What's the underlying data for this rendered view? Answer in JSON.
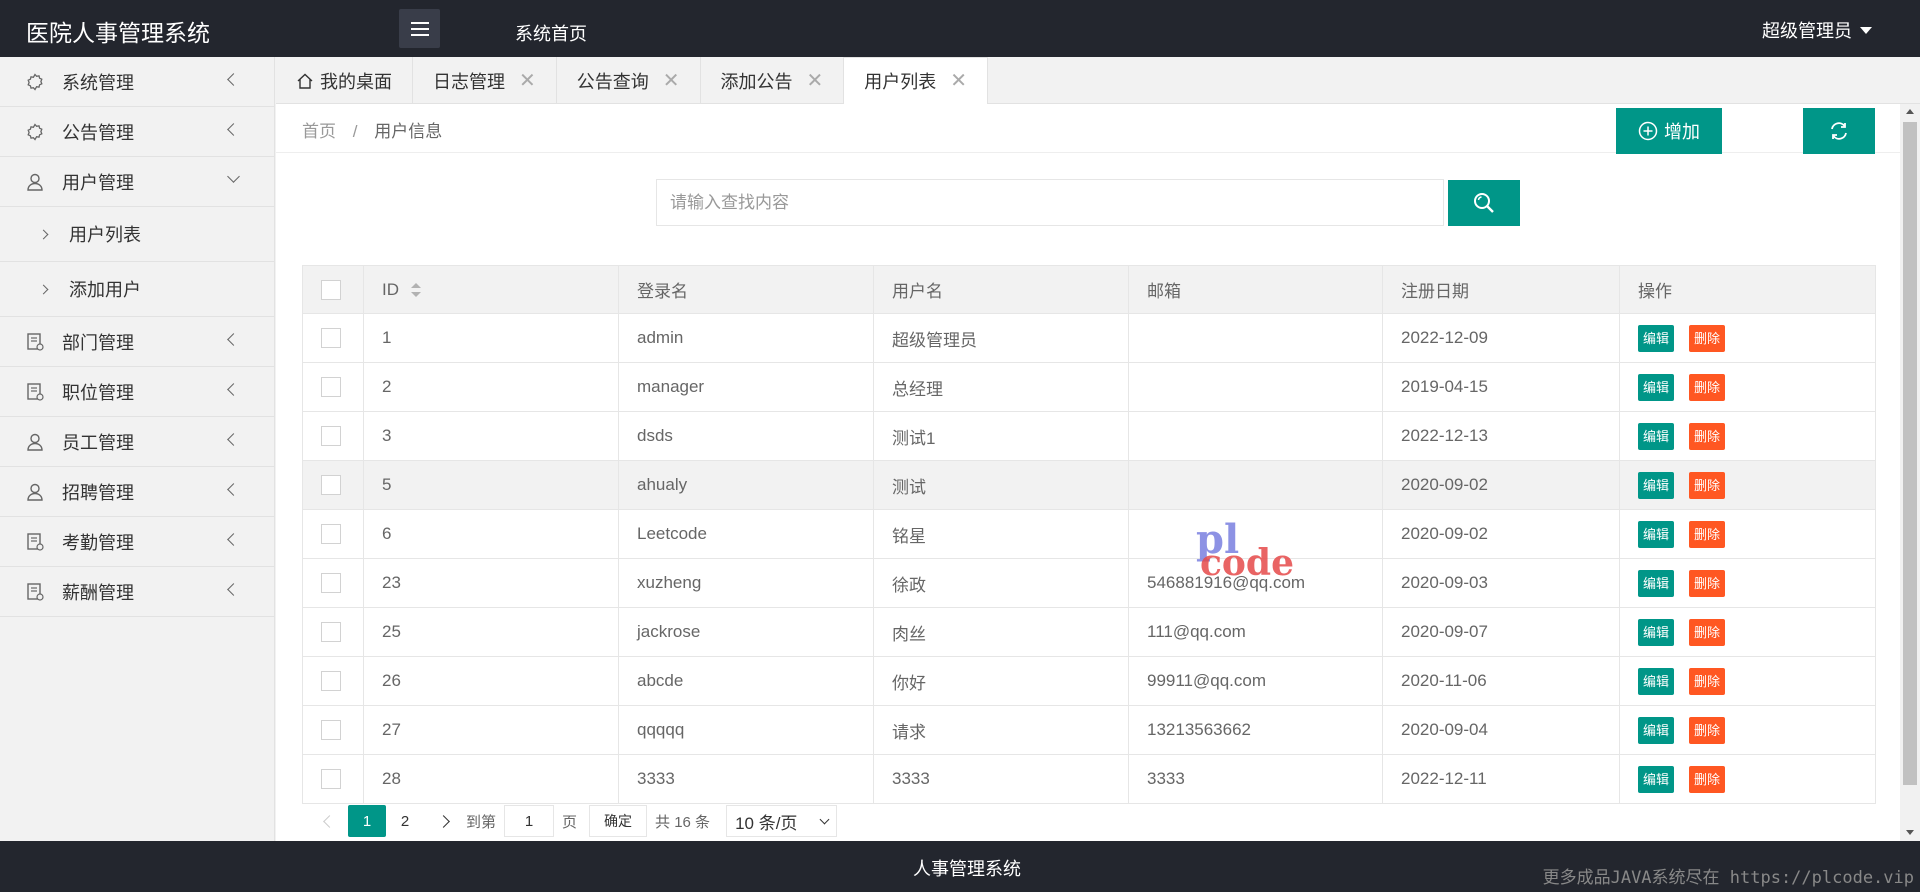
{
  "app": {
    "title": "医院人事管理系统",
    "home_link": "系统首页",
    "user": "超级管理员"
  },
  "sidebar": {
    "items": [
      {
        "label": "系统管理",
        "icon": "cog-icon"
      },
      {
        "label": "公告管理",
        "icon": "cog-icon"
      },
      {
        "label": "用户管理",
        "icon": "user-icon",
        "expanded": true,
        "children": [
          {
            "label": "用户列表"
          },
          {
            "label": "添加用户"
          }
        ]
      },
      {
        "label": "部门管理",
        "icon": "document-icon"
      },
      {
        "label": "职位管理",
        "icon": "document-icon"
      },
      {
        "label": "员工管理",
        "icon": "user-icon"
      },
      {
        "label": "招聘管理",
        "icon": "user-icon"
      },
      {
        "label": "考勤管理",
        "icon": "document-icon"
      },
      {
        "label": "薪酬管理",
        "icon": "document-icon"
      }
    ]
  },
  "tabs": [
    {
      "label": "我的桌面",
      "closable": false,
      "active": false
    },
    {
      "label": "日志管理",
      "closable": true,
      "active": false
    },
    {
      "label": "公告查询",
      "closable": true,
      "active": false
    },
    {
      "label": "添加公告",
      "closable": true,
      "active": false
    },
    {
      "label": "用户列表",
      "closable": true,
      "active": true
    }
  ],
  "tab_close_glyph": "✕",
  "breadcrumb": {
    "home": "首页",
    "separator": "/",
    "current": "用户信息"
  },
  "toolbar": {
    "add_label": "增加"
  },
  "search": {
    "placeholder": "请输入查找内容",
    "value": ""
  },
  "table": {
    "headers": [
      "ID",
      "登录名",
      "用户名",
      "邮箱",
      "注册日期",
      "操作"
    ],
    "edit_label": "编辑",
    "delete_label": "删除",
    "rows": [
      {
        "id": "1",
        "login": "admin",
        "name": "超级管理员",
        "email": "",
        "date": "2022-12-09"
      },
      {
        "id": "2",
        "login": "manager",
        "name": "总经理",
        "email": "",
        "date": "2019-04-15"
      },
      {
        "id": "3",
        "login": "dsds",
        "name": "测试1",
        "email": "",
        "date": "2022-12-13"
      },
      {
        "id": "5",
        "login": "ahualy",
        "name": "测试",
        "email": "",
        "date": "2020-09-02"
      },
      {
        "id": "6",
        "login": "Leetcode",
        "name": "铭星",
        "email": "",
        "date": "2020-09-02"
      },
      {
        "id": "23",
        "login": "xuzheng",
        "name": "徐政",
        "email": "546881916@qq.com",
        "date": "2020-09-03"
      },
      {
        "id": "25",
        "login": "jackrose",
        "name": "肉丝",
        "email": "111@qq.com",
        "date": "2020-09-07"
      },
      {
        "id": "26",
        "login": "abcde",
        "name": "你好",
        "email": "99911@qq.com",
        "date": "2020-11-06"
      },
      {
        "id": "27",
        "login": "qqqqq",
        "name": "请求",
        "email": "13213563662",
        "date": "2020-09-04"
      },
      {
        "id": "28",
        "login": "3333",
        "name": "3333",
        "email": "3333",
        "date": "2022-12-11"
      }
    ],
    "highlighted_row": 3
  },
  "pagination": {
    "pages": [
      "1",
      "2"
    ],
    "current": "1",
    "goto_prefix": "到第",
    "goto_value": "1",
    "goto_suffix": "页",
    "confirm": "确定",
    "total": "共 16 条",
    "page_size": "10 条/页"
  },
  "footer": {
    "text": "人事管理系统",
    "watermark": "更多成品JAVA系统尽在 https://plcode.vip"
  },
  "logo_watermark": {
    "top": "pl",
    "bottom": "code"
  },
  "colors": {
    "primary": "#009688",
    "danger": "#ff5722",
    "header": "#23262e"
  }
}
